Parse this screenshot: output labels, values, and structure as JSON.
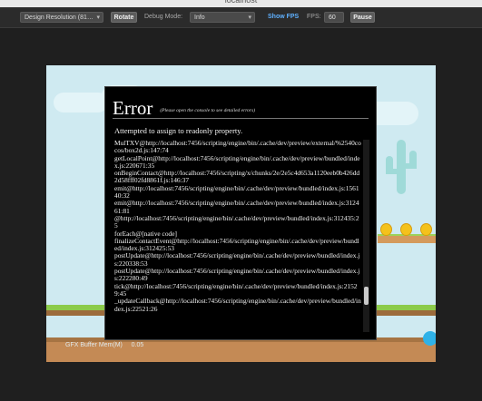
{
  "browser": {
    "url": "localhost"
  },
  "toolbar": {
    "resolution_select": "Design Resolution (81…",
    "rotate_label": "Rotate",
    "debug_mode_label": "Debug Mode:",
    "debug_mode_value": "Info",
    "show_fps_label": "Show FPS",
    "fps_label": "FPS:",
    "fps_value": "60",
    "pause_label": "Pause"
  },
  "error_dialog": {
    "title": "Error",
    "hint": "(Please open the console to see detailed errors)",
    "message": "Attempted to assign to readonly property.",
    "stack": [
      "MulTXV@http://localhost:7456/scripting/engine/bin/.cache/dev/preview/external/%2540cocos/box2d.js:147:74",
      "getLocalPoint@http://localhost:7456/scripting/engine/bin/.cache/dev/preview/bundled/index.js:220671:35",
      "onBeginContact@http://localhost:7456/scripting/x/chunks/2e/2e5c4d653a1120eeb0b426dd2d58fff02fd8861f.js:146:37",
      "emit@http://localhost:7456/scripting/engine/bin/.cache/dev/preview/bundled/index.js:156140:32",
      "emit@http://localhost:7456/scripting/engine/bin/.cache/dev/preview/bundled/index.js:312461:81",
      "@http://localhost:7456/scripting/engine/bin/.cache/dev/preview/bundled/index.js:312435:25",
      "forEach@[native code]",
      "finalizeContactEvent@http://localhost:7456/scripting/engine/bin/.cache/dev/preview/bundled/index.js:312425:53",
      "postUpdate@http://localhost:7456/scripting/engine/bin/.cache/dev/preview/bundled/index.js:220338:53",
      "postUpdate@http://localhost:7456/scripting/engine/bin/.cache/dev/preview/bundled/index.js:222280:49",
      "tick@http://localhost:7456/scripting/engine/bin/.cache/dev/preview/bundled/index.js:21529:45",
      "_updateCallback@http://localhost:7456/scripting/engine/bin/.cache/dev/preview/bundled/index.js:22521:26"
    ]
  },
  "game_stats": {
    "visible_label": "GFX Buffer Mem(M)",
    "visible_value": "0.05"
  },
  "colors": {
    "toolbar_bg": "#2b2b2b",
    "link_accent": "#5fb1ff",
    "dialog_bg": "#000000",
    "sky": "#cfeaf1",
    "grass": "#8ccb4a",
    "coin": "#f4c21c"
  }
}
